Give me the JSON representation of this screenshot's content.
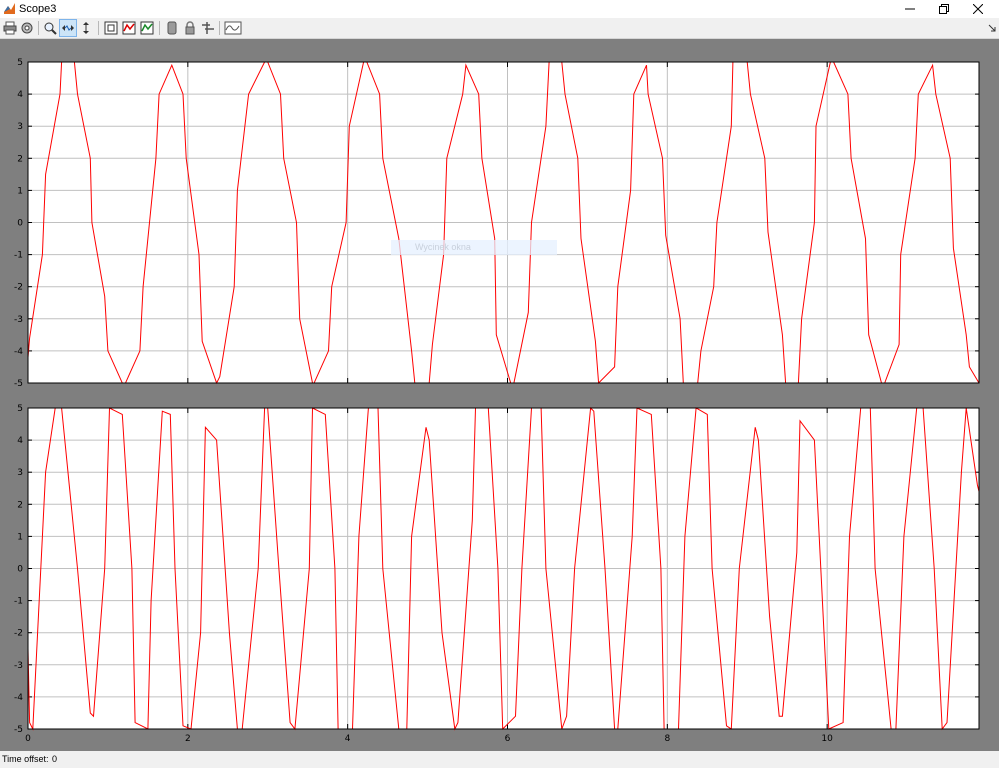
{
  "window": {
    "title": "Scope3",
    "icons": {
      "app": "matlab-icon",
      "minimize": "minimize-icon",
      "maximize": "restore-icon",
      "close": "close-icon"
    }
  },
  "toolbar": {
    "items": [
      {
        "name": "print-icon"
      },
      {
        "name": "parameters-icon"
      },
      {
        "name": "zoom-icon"
      },
      {
        "name": "zoom-x-icon"
      },
      {
        "name": "zoom-y-icon"
      },
      {
        "name": "autoscale-icon"
      },
      {
        "name": "save-axes-icon"
      },
      {
        "name": "restore-axes-icon"
      },
      {
        "name": "floating-scope-icon"
      },
      {
        "name": "lock-axes-icon"
      },
      {
        "name": "signal-selection-icon"
      },
      {
        "name": "viewer-icon"
      }
    ],
    "expand_icon": "chevron-expand-icon"
  },
  "overlay": {
    "text": "Wycinek okna"
  },
  "status": {
    "time_offset_label": "Time offset:",
    "time_offset_value": "0"
  },
  "colors": {
    "trace": "#ff0000",
    "plot_bg": "#ffffff",
    "frame_bg": "#7f7f7f",
    "grid": "#c0c0c0"
  },
  "chart_data": [
    {
      "type": "line",
      "title": "",
      "xlabel": "",
      "ylabel": "",
      "xlim": [
        0,
        11.9
      ],
      "ylim": [
        -5,
        5
      ],
      "xticks": [
        "0",
        "2",
        "4",
        "6",
        "8",
        "10"
      ],
      "yticks": [
        "5",
        "4",
        "3",
        "2",
        "1",
        "0",
        "-1",
        "-2",
        "-3",
        "-4",
        "-5"
      ],
      "grid": true,
      "series": [
        {
          "color": "#ff0000",
          "x": [
            0.0,
            0.02,
            0.18,
            0.22,
            0.4,
            0.42,
            0.58,
            0.62,
            0.78,
            0.8,
            0.96,
            1.0,
            1.18,
            1.22,
            1.4,
            1.44,
            1.6,
            1.64,
            1.8,
            1.94,
            1.98,
            2.14,
            2.18,
            2.36,
            2.4,
            2.58,
            2.62,
            2.76,
            2.96,
            3.0,
            3.16,
            3.2,
            3.36,
            3.4,
            3.56,
            3.58,
            3.76,
            3.8,
            3.98,
            4.02,
            4.2,
            4.24,
            4.4,
            4.44,
            4.64,
            4.8,
            4.84,
            5.02,
            5.06,
            5.2,
            5.24,
            5.44,
            5.48,
            5.64,
            5.68,
            5.84,
            5.86,
            6.04,
            6.08,
            6.26,
            6.3,
            6.48,
            6.52,
            6.68,
            6.72,
            6.88,
            6.92,
            7.1,
            7.14,
            7.34,
            7.38,
            7.54,
            7.58,
            7.74,
            7.76,
            7.94,
            7.98,
            8.16,
            8.2,
            8.38,
            8.42,
            8.58,
            8.62,
            8.8,
            8.82,
            9.0,
            9.04,
            9.22,
            9.26,
            9.44,
            9.48,
            9.64,
            9.68,
            9.84,
            9.86,
            10.04,
            10.08,
            10.26,
            10.3,
            10.48,
            10.52,
            10.68,
            10.72,
            10.9,
            10.92,
            11.1,
            11.14,
            11.32,
            11.36,
            11.54,
            11.58,
            11.74,
            11.78,
            11.9
          ],
          "y": [
            -4.2,
            -3.6,
            -1.0,
            1.5,
            4.0,
            5.0,
            5.0,
            4.0,
            2.0,
            0.0,
            -2.3,
            -4.0,
            -5.0,
            -5.0,
            -4.0,
            -2.0,
            2.0,
            4.0,
            4.9,
            4.0,
            2.0,
            -1.0,
            -3.7,
            -5.0,
            -4.8,
            -2.0,
            1.0,
            4.0,
            5.0,
            5.0,
            4.0,
            2.0,
            0.0,
            -3.0,
            -5.0,
            -5.0,
            -4.0,
            -2.0,
            0.0,
            3.0,
            5.0,
            5.0,
            4.0,
            2.0,
            -0.5,
            -4.0,
            -5.0,
            -5.0,
            -3.8,
            -1.0,
            2.0,
            4.0,
            4.9,
            4.0,
            2.0,
            -0.5,
            -3.5,
            -5.0,
            -5.0,
            -2.8,
            0.0,
            3.0,
            5.0,
            5.0,
            4.0,
            2.0,
            -0.5,
            -3.7,
            -5.0,
            -4.5,
            -2.0,
            1.0,
            4.0,
            4.9,
            4.0,
            2.0,
            -0.4,
            -3.0,
            -5.0,
            -5.0,
            -4.0,
            -2.0,
            0.0,
            3.0,
            5.0,
            5.0,
            4.0,
            2.0,
            -0.3,
            -3.5,
            -5.0,
            -5.0,
            -3.0,
            0.0,
            3.0,
            5.0,
            5.0,
            4.0,
            2.0,
            -0.5,
            -3.5,
            -5.0,
            -5.0,
            -3.8,
            -1.0,
            2.0,
            4.0,
            4.9,
            4.0,
            2.0,
            -0.8,
            -3.5,
            -4.5,
            -5.0
          ]
        }
      ]
    },
    {
      "type": "line",
      "title": "",
      "xlabel": "",
      "ylabel": "",
      "xlim": [
        0,
        11.9
      ],
      "ylim": [
        -5,
        5
      ],
      "xticks": [
        "0",
        "2",
        "4",
        "6",
        "8",
        "10"
      ],
      "yticks": [
        "5",
        "4",
        "3",
        "2",
        "1",
        "0",
        "-1",
        "-2",
        "-3",
        "-4",
        "-5"
      ],
      "grid": true,
      "series": [
        {
          "color": "#ff0000",
          "x": [
            0.0,
            0.02,
            0.06,
            0.22,
            0.34,
            0.42,
            0.46,
            0.62,
            0.78,
            0.82,
            0.96,
            1.02,
            1.18,
            1.3,
            1.34,
            1.5,
            1.54,
            1.68,
            1.78,
            1.84,
            1.94,
            2.04,
            2.16,
            2.22,
            2.36,
            2.52,
            2.62,
            2.68,
            2.88,
            2.96,
            3.0,
            3.14,
            3.28,
            3.34,
            3.52,
            3.56,
            3.72,
            3.84,
            3.88,
            4.06,
            4.14,
            4.26,
            4.38,
            4.44,
            4.64,
            4.74,
            4.8,
            4.98,
            5.02,
            5.18,
            5.34,
            5.38,
            5.56,
            5.6,
            5.76,
            5.88,
            5.94,
            6.1,
            6.18,
            6.3,
            6.42,
            6.48,
            6.68,
            6.74,
            6.84,
            7.04,
            7.08,
            7.22,
            7.34,
            7.38,
            7.56,
            7.62,
            7.8,
            7.92,
            7.96,
            8.14,
            8.22,
            8.36,
            8.5,
            8.56,
            8.74,
            8.8,
            8.9,
            9.1,
            9.14,
            9.28,
            9.4,
            9.44,
            9.62,
            9.66,
            9.84,
            9.96,
            10.02,
            10.2,
            10.28,
            10.42,
            10.54,
            10.6,
            10.8,
            10.86,
            10.96,
            11.12,
            11.2,
            11.34,
            11.44,
            11.5,
            11.68,
            11.74,
            11.88,
            11.9
          ],
          "y": [
            -2.5,
            -4.8,
            -5.0,
            3.0,
            5.0,
            5.0,
            4.0,
            0.0,
            -4.5,
            -4.6,
            0.0,
            5.0,
            4.8,
            0.0,
            -4.8,
            -5.0,
            -1.0,
            4.9,
            4.8,
            0.0,
            -4.9,
            -5.0,
            -2.0,
            4.4,
            4.0,
            -2.0,
            -5.0,
            -5.0,
            0.0,
            5.0,
            5.0,
            0.0,
            -4.8,
            -5.0,
            0.0,
            5.0,
            4.8,
            0.0,
            -5.0,
            -5.0,
            1.0,
            5.0,
            5.0,
            0.0,
            -5.0,
            -5.0,
            1.0,
            4.4,
            4.0,
            -2.0,
            -5.0,
            -4.8,
            1.5,
            5.0,
            5.0,
            0.0,
            -5.0,
            -4.6,
            0.0,
            5.0,
            5.0,
            0.0,
            -5.0,
            -4.6,
            0.0,
            5.0,
            4.9,
            0.0,
            -5.0,
            -5.0,
            1.0,
            5.0,
            4.8,
            0.0,
            -5.0,
            -5.0,
            1.0,
            5.0,
            4.8,
            0.0,
            -4.9,
            -5.0,
            0.0,
            4.4,
            4.0,
            -1.5,
            -4.6,
            -4.6,
            0.5,
            4.6,
            4.0,
            -2.0,
            -5.0,
            -4.8,
            1.0,
            5.0,
            5.0,
            0.0,
            -5.0,
            -5.0,
            1.0,
            5.0,
            5.0,
            0.0,
            -5.0,
            -4.8,
            3.0,
            5.0,
            2.6,
            2.4
          ]
        }
      ]
    }
  ]
}
